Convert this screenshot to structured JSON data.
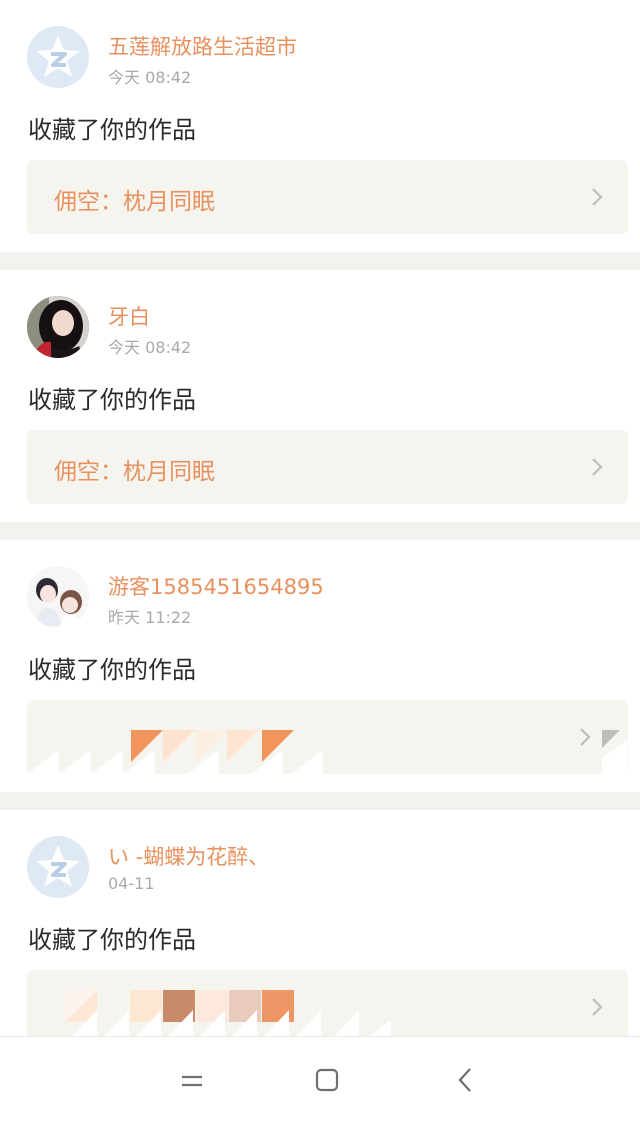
{
  "feed": [
    {
      "user_name": "五莲解放路生活超市",
      "time": "今天 08:42",
      "avatar": "default-z-icon",
      "action": "收藏了你的作品",
      "work_title": "佣空：枕月同眠"
    },
    {
      "user_name": "牙白",
      "time": "今天 08:42",
      "avatar": "user-photo",
      "action": "收藏了你的作品",
      "work_title": "佣空：枕月同眠"
    },
    {
      "user_name": "游客1585451654895",
      "time": "昨天 11:22",
      "avatar": "anime-couple-photo",
      "action": "收藏了你的作品",
      "work_title": ""
    },
    {
      "user_name": "い -蝴蝶为花醉、",
      "time": "04-11",
      "avatar": "default-z-icon",
      "action": "收藏了你的作品",
      "work_title": ""
    }
  ],
  "colors": {
    "accent": "#e8915e",
    "card_bg": "#f5f4ee",
    "separator": "#f3f2ee",
    "time_text": "#a9a9a9",
    "body_text": "#2b2b2b"
  },
  "navbar": {
    "menu_icon": "menu-icon",
    "home_icon": "home-icon",
    "back_icon": "back-icon"
  }
}
